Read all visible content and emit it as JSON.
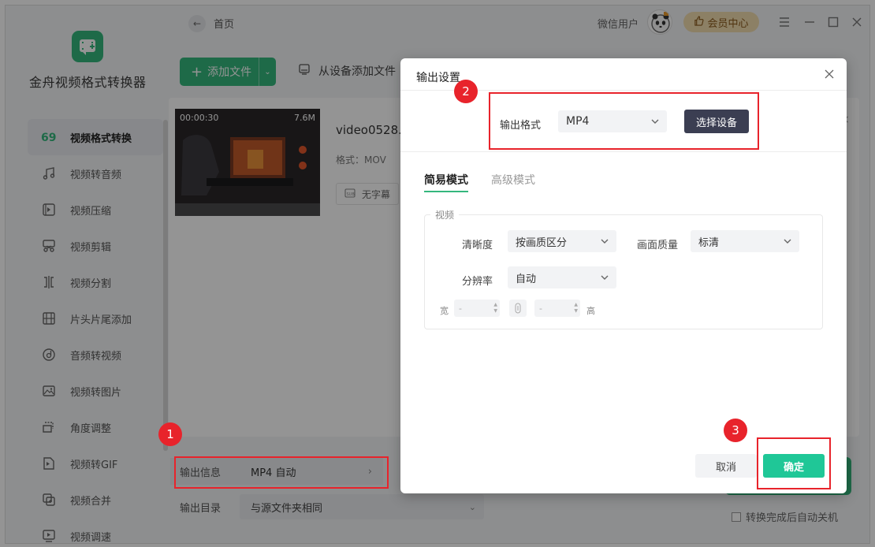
{
  "app": {
    "name": "金舟视频格式转换器"
  },
  "topbar": {
    "home": "首页",
    "user_name": "微信用户",
    "vip": "会员中心"
  },
  "sidebar": {
    "items": [
      {
        "label": "视频格式转换",
        "icon": "format-convert-icon",
        "active": true
      },
      {
        "label": "视频转音频",
        "icon": "music-note-icon",
        "active": false
      },
      {
        "label": "视频压缩",
        "icon": "compress-icon",
        "active": false
      },
      {
        "label": "视频剪辑",
        "icon": "scissors-icon",
        "active": false
      },
      {
        "label": "视频分割",
        "icon": "split-icon",
        "active": false
      },
      {
        "label": "片头片尾添加",
        "icon": "film-icon",
        "active": false
      },
      {
        "label": "音频转视频",
        "icon": "disc-icon",
        "active": false
      },
      {
        "label": "视频转图片",
        "icon": "image-icon",
        "active": false
      },
      {
        "label": "角度调整",
        "icon": "rotate-icon",
        "active": false
      },
      {
        "label": "视频转GIF",
        "icon": "gif-icon",
        "active": false
      },
      {
        "label": "视频合并",
        "icon": "merge-icon",
        "active": false
      },
      {
        "label": "视频调速",
        "icon": "speed-icon",
        "active": false
      }
    ]
  },
  "toolbar": {
    "add_file": "添加文件",
    "add_from_device": "从设备添加文件"
  },
  "file": {
    "duration": "00:00:30",
    "size": "7.6M",
    "name": "video0528.",
    "format": "格式：MOV",
    "subtitle": "无字幕"
  },
  "bottom": {
    "output_info_label": "输出信息",
    "output_info_value": "MP4 自动",
    "output_dir_label": "输出目录",
    "output_dir_value": "与源文件夹相同",
    "auto_shutdown": "转换完成后自动关机"
  },
  "dialog": {
    "title": "输出设置",
    "format_label": "输出格式",
    "format_value": "MP4",
    "choose_device": "选择设备",
    "tabs": [
      "简易模式",
      "高级模式"
    ],
    "group_label": "视频",
    "clarity_label": "清晰度",
    "clarity_value": "按画质区分",
    "quality_label": "画面质量",
    "quality_value": "标清",
    "resolution_label": "分辨率",
    "resolution_value": "自动",
    "width_label": "宽",
    "height_label": "高",
    "width_placeholder": "-",
    "height_placeholder": "-",
    "cancel": "取消",
    "confirm": "确定"
  },
  "annotations": {
    "markers": [
      "1",
      "2",
      "3"
    ],
    "color": "#e8232b"
  },
  "colors": {
    "accent": "#34b77d",
    "confirm": "#1fc797",
    "device_button": "#3b3e52"
  }
}
